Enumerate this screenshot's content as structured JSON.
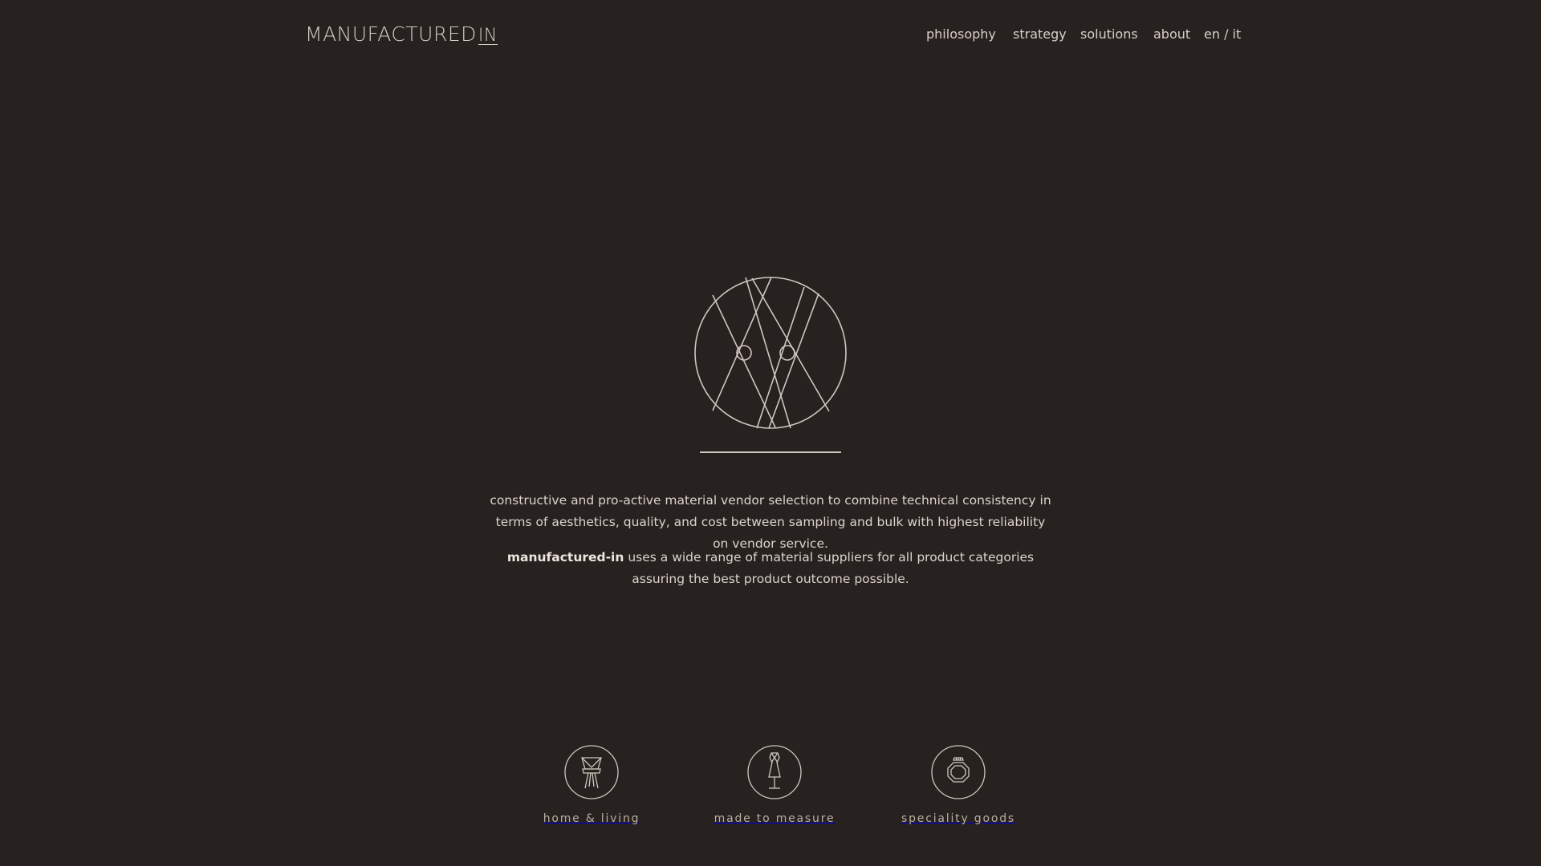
{
  "header": {
    "logo": {
      "text": "MANUFACTURED",
      "suffix": "IN"
    },
    "nav": [
      {
        "label": "philosophy"
      },
      {
        "label": "strategy"
      },
      {
        "label": "solutions"
      },
      {
        "label": "about"
      },
      {
        "label": "en / it"
      }
    ]
  },
  "hero": {
    "emblem_icon": "material-selection-emblem-icon",
    "paragraph1": "constructive and pro-active material vendor selection to combine technical consistency in terms of aesthetics, quality, and cost between sampling and bulk with highest reliability on vendor service.",
    "paragraph2_brand": "manufactured-in",
    "paragraph2_rest": " uses a wide range of material suppliers for all product categories assuring the best product outcome possible."
  },
  "categories": [
    {
      "label": "home & living",
      "icon": "chair-icon"
    },
    {
      "label": "made to measure",
      "icon": "dress-form-icon"
    },
    {
      "label": "speciality goods",
      "icon": "ring-icon"
    }
  ],
  "colors": {
    "background": "#272120",
    "line": "#cfc6bd",
    "text": "#ddd4cb"
  }
}
